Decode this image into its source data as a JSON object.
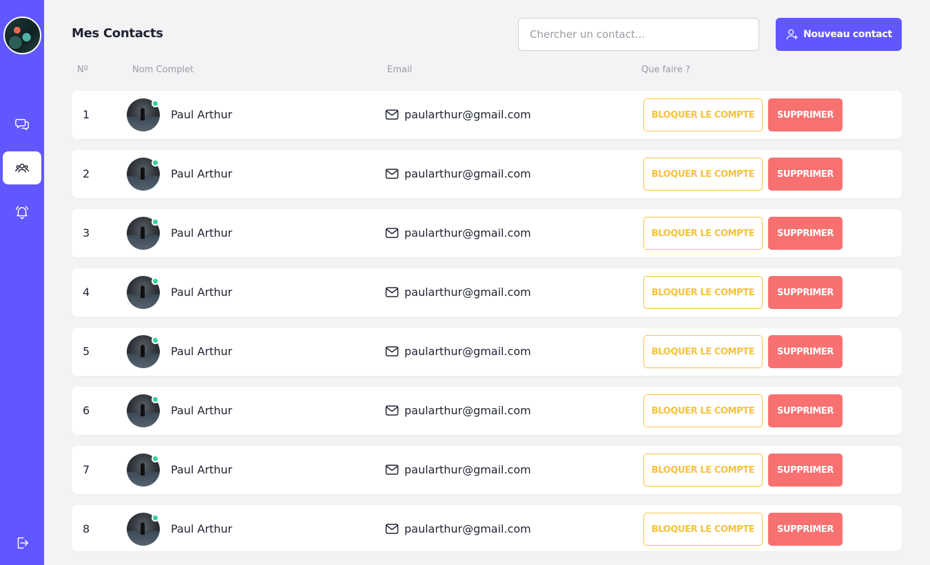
{
  "page": {
    "title": "Mes Contacts"
  },
  "search": {
    "placeholder": "Chercher un contact..."
  },
  "new_contact": {
    "label": "Nouveau contact",
    "icon": "user-plus-icon"
  },
  "columns": {
    "number": "Nº",
    "name": "Nom Complet",
    "email": "Email",
    "actions": "Que faire ?"
  },
  "sidebar": {
    "items": [
      {
        "icon": "chat-icon",
        "active": false
      },
      {
        "icon": "contacts-icon",
        "active": true
      },
      {
        "icon": "bell-icon",
        "active": false
      },
      {
        "icon": "logout-icon",
        "active": false
      }
    ]
  },
  "contacts": [
    {
      "num": "1",
      "name": "Paul Arthur",
      "email": "paularthur@gmail.com",
      "online": true
    },
    {
      "num": "2",
      "name": "Paul Arthur",
      "email": "paularthur@gmail.com",
      "online": true
    },
    {
      "num": "3",
      "name": "Paul Arthur",
      "email": "paularthur@gmail.com",
      "online": true
    },
    {
      "num": "4",
      "name": "Paul Arthur",
      "email": "paularthur@gmail.com",
      "online": true
    },
    {
      "num": "5",
      "name": "Paul Arthur",
      "email": "paularthur@gmail.com",
      "online": true
    },
    {
      "num": "6",
      "name": "Paul Arthur",
      "email": "paularthur@gmail.com",
      "online": true
    },
    {
      "num": "7",
      "name": "Paul Arthur",
      "email": "paularthur@gmail.com",
      "online": true
    },
    {
      "num": "8",
      "name": "Paul Arthur",
      "email": "paularthur@gmail.com",
      "online": true
    }
  ],
  "actions": {
    "block_label": "BLOQUER LE COMPTE",
    "delete_label": "SUPPRIMER"
  },
  "colors": {
    "accent": "#6157ff",
    "block": "#f6c23e",
    "delete": "#f87171",
    "online": "#34d399"
  }
}
